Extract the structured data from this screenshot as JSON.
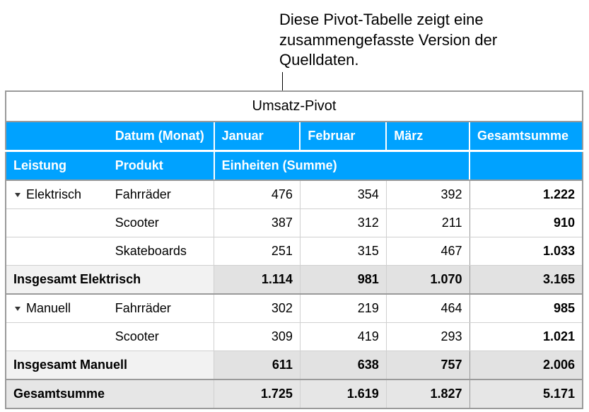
{
  "annotation": "Diese Pivot-Tabelle zeigt eine zusammengefasste Version der Quelldaten.",
  "title": "Umsatz-Pivot",
  "headers": {
    "dateGroup": "Datum (Monat)",
    "jan": "Januar",
    "feb": "Februar",
    "mar": "März",
    "grandTotal": "Gesamtsumme",
    "performance": "Leistung",
    "product": "Produkt",
    "unitsSum": "Einheiten (Summe)"
  },
  "groups": {
    "elektrisch": {
      "name": "Elektrisch",
      "rows": {
        "fahrraeder": {
          "label": "Fahrräder",
          "jan": "476",
          "feb": "354",
          "mar": "392",
          "total": "1.222"
        },
        "scooter": {
          "label": "Scooter",
          "jan": "387",
          "feb": "312",
          "mar": "211",
          "total": "910"
        },
        "skateboards": {
          "label": "Skateboards",
          "jan": "251",
          "feb": "315",
          "mar": "467",
          "total": "1.033"
        }
      },
      "subtotal": {
        "label": "Insgesamt Elektrisch",
        "jan": "1.114",
        "feb": "981",
        "mar": "1.070",
        "total": "3.165"
      }
    },
    "manuell": {
      "name": "Manuell",
      "rows": {
        "fahrraeder": {
          "label": "Fahrräder",
          "jan": "302",
          "feb": "219",
          "mar": "464",
          "total": "985"
        },
        "scooter": {
          "label": "Scooter",
          "jan": "309",
          "feb": "419",
          "mar": "293",
          "total": "1.021"
        }
      },
      "subtotal": {
        "label": "Insgesamt Manuell",
        "jan": "611",
        "feb": "638",
        "mar": "757",
        "total": "2.006"
      }
    }
  },
  "grandTotal": {
    "label": "Gesamtsumme",
    "jan": "1.725",
    "feb": "1.619",
    "mar": "1.827",
    "total": "5.171"
  },
  "chart_data": {
    "type": "table",
    "title": "Umsatz-Pivot",
    "row_dimensions": [
      "Leistung",
      "Produkt"
    ],
    "column_dimension": "Datum (Monat)",
    "measure": "Einheiten (Summe)",
    "columns": [
      "Januar",
      "Februar",
      "März",
      "Gesamtsumme"
    ],
    "rows": [
      {
        "Leistung": "Elektrisch",
        "Produkt": "Fahrräder",
        "Januar": 476,
        "Februar": 354,
        "März": 392,
        "Gesamtsumme": 1222
      },
      {
        "Leistung": "Elektrisch",
        "Produkt": "Scooter",
        "Januar": 387,
        "Februar": 312,
        "März": 211,
        "Gesamtsumme": 910
      },
      {
        "Leistung": "Elektrisch",
        "Produkt": "Skateboards",
        "Januar": 251,
        "Februar": 315,
        "März": 467,
        "Gesamtsumme": 1033
      },
      {
        "Leistung": "Elektrisch",
        "Produkt": "Insgesamt",
        "Januar": 1114,
        "Februar": 981,
        "März": 1070,
        "Gesamtsumme": 3165
      },
      {
        "Leistung": "Manuell",
        "Produkt": "Fahrräder",
        "Januar": 302,
        "Februar": 219,
        "März": 464,
        "Gesamtsumme": 985
      },
      {
        "Leistung": "Manuell",
        "Produkt": "Scooter",
        "Januar": 309,
        "Februar": 419,
        "März": 293,
        "Gesamtsumme": 1021
      },
      {
        "Leistung": "Manuell",
        "Produkt": "Insgesamt",
        "Januar": 611,
        "Februar": 638,
        "März": 757,
        "Gesamtsumme": 2006
      },
      {
        "Leistung": "Gesamtsumme",
        "Produkt": "",
        "Januar": 1725,
        "Februar": 1619,
        "März": 1827,
        "Gesamtsumme": 5171
      }
    ]
  }
}
